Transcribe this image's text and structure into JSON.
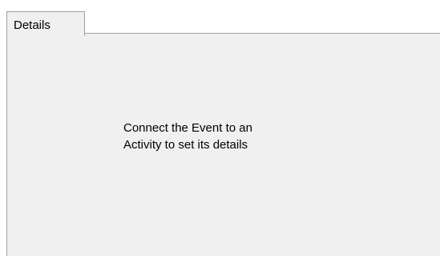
{
  "tabs": [
    {
      "label": "Details",
      "selected": true
    }
  ],
  "panel": {
    "message_lines": [
      "Connect the Event to an",
      "Activity to set its details"
    ]
  },
  "colors": {
    "panel_background": "#f0f0f0",
    "border": "#a0a0a0"
  }
}
